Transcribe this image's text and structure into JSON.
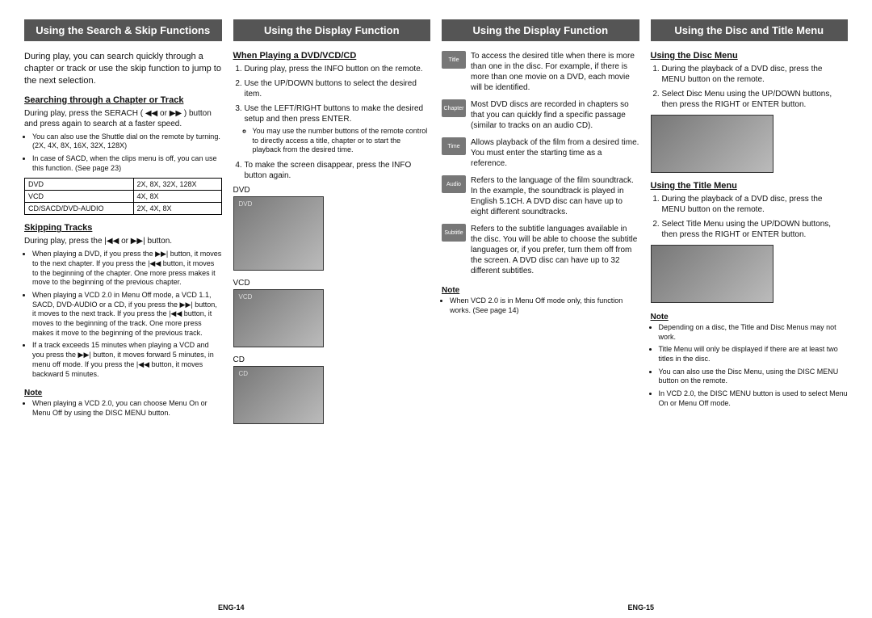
{
  "col1": {
    "header": "Using the Search & Skip Functions",
    "intro": "During play, you can search quickly through a chapter or track or use the skip function to jump to the next selection.",
    "sub1": "Searching through a Chapter or Track",
    "p1": "During play, press the SERACH ( ◀◀ or ▶▶ ) button and press again to search at a faster speed.",
    "b1a": "You can also use the Shuttle dial on the remote by turning. (2X, 4X, 8X, 16X, 32X, 128X)",
    "b1b": "In case of SACD, when the clips menu is off, you can use this function. (See page 23)",
    "table": {
      "r1c1": "DVD",
      "r1c2": "2X, 8X, 32X, 128X",
      "r2c1": "VCD",
      "r2c2": "4X, 8X",
      "r3c1": "CD/SACD/DVD-AUDIO",
      "r3c2": "2X, 4X, 8X"
    },
    "sub2": "Skipping Tracks",
    "p2": "During play, press the |◀◀ or ▶▶| button.",
    "b2a": "When playing a DVD, if you press the ▶▶| button, it moves to the next chapter. If you press the |◀◀ button, it moves to the beginning of the chapter. One more press makes it move to the beginning of the previous chapter.",
    "b2b": "When playing a VCD 2.0 in Menu Off mode, a VCD 1.1, SACD, DVD-AUDIO or a CD, if you press the ▶▶| button, it moves to the next track. If you press the |◀◀ button, it moves to the beginning of the track. One more press makes it move to the beginning of the previous track.",
    "b2c": "If a track exceeds 15 minutes when playing a VCD and you press the ▶▶| button, it moves forward 5 minutes, in menu off mode. If you press the |◀◀ button, it moves backward 5 minutes.",
    "note": "Note",
    "nb": "When playing a VCD 2.0, you can choose Menu On or Menu Off by using the DISC MENU button."
  },
  "col2": {
    "header": "Using the Display Function",
    "sub1": "When Playing a DVD/VCD/CD",
    "s1": "During play, press the INFO button on the remote.",
    "s2": "Use the UP/DOWN buttons to select the desired item.",
    "s3": "Use the LEFT/RIGHT buttons to make the desired setup and then press ENTER.",
    "s3b": "You may use the number buttons of the remote control to directly access a title, chapter or to start the playback from the desired time.",
    "s4": "To make the screen disappear, press the INFO button again.",
    "l1": "DVD",
    "l2": "VCD",
    "l3": "CD"
  },
  "col3": {
    "header": "Using the Display Function",
    "title": {
      "label": "Title",
      "txt": "To access the desired title when there is more than one in the disc.\nFor example, if there is more than one movie on a DVD, each movie will be identified."
    },
    "chapter": {
      "label": "Chapter",
      "txt": "Most DVD discs are recorded in chapters so that you can quickly find a specific passage (similar to tracks on an audio CD)."
    },
    "time": {
      "label": "Time",
      "txt": "Allows playback of the film from a desired time. You must enter the starting time as a reference."
    },
    "audio": {
      "label": "Audio",
      "txt": "Refers to the language of the film soundtrack. In the example, the soundtrack is played in English 5.1CH. A DVD disc can have up to eight different soundtracks."
    },
    "subtitle": {
      "label": "Subtitle",
      "txt": "Refers to the subtitle languages available in the disc.\nYou will be able to choose the subtitle languages or, if you prefer, turn them off from the screen.\nA DVD disc can have up to 32 different subtitles."
    },
    "note": "Note",
    "nb": "When VCD 2.0 is in Menu Off mode only, this function works. (See page 14)"
  },
  "col4": {
    "header": "Using the Disc and Title Menu",
    "sub1": "Using the Disc Menu",
    "d1": "During the playback of a DVD disc, press the MENU button on the remote.",
    "d2": "Select Disc Menu using the UP/DOWN buttons, then press the RIGHT or ENTER button.",
    "sub2": "Using the Title Menu",
    "t1": "During the playback of a DVD disc, press the MENU button on the remote.",
    "t2": "Select Title Menu using the UP/DOWN buttons, then press the RIGHT or ENTER button.",
    "note": "Note",
    "n1": "Depending on a disc, the Title and Disc Menus may not work.",
    "n2": "Title Menu will only be displayed if there are at least two titles in the disc.",
    "n3": "You can also use the Disc Menu, using the DISC MENU button on the remote.",
    "n4": "In VCD 2.0, the DISC MENU button is used to select Menu On or Menu Off mode."
  },
  "footer": {
    "left": "ENG-14",
    "right": "ENG-15"
  }
}
